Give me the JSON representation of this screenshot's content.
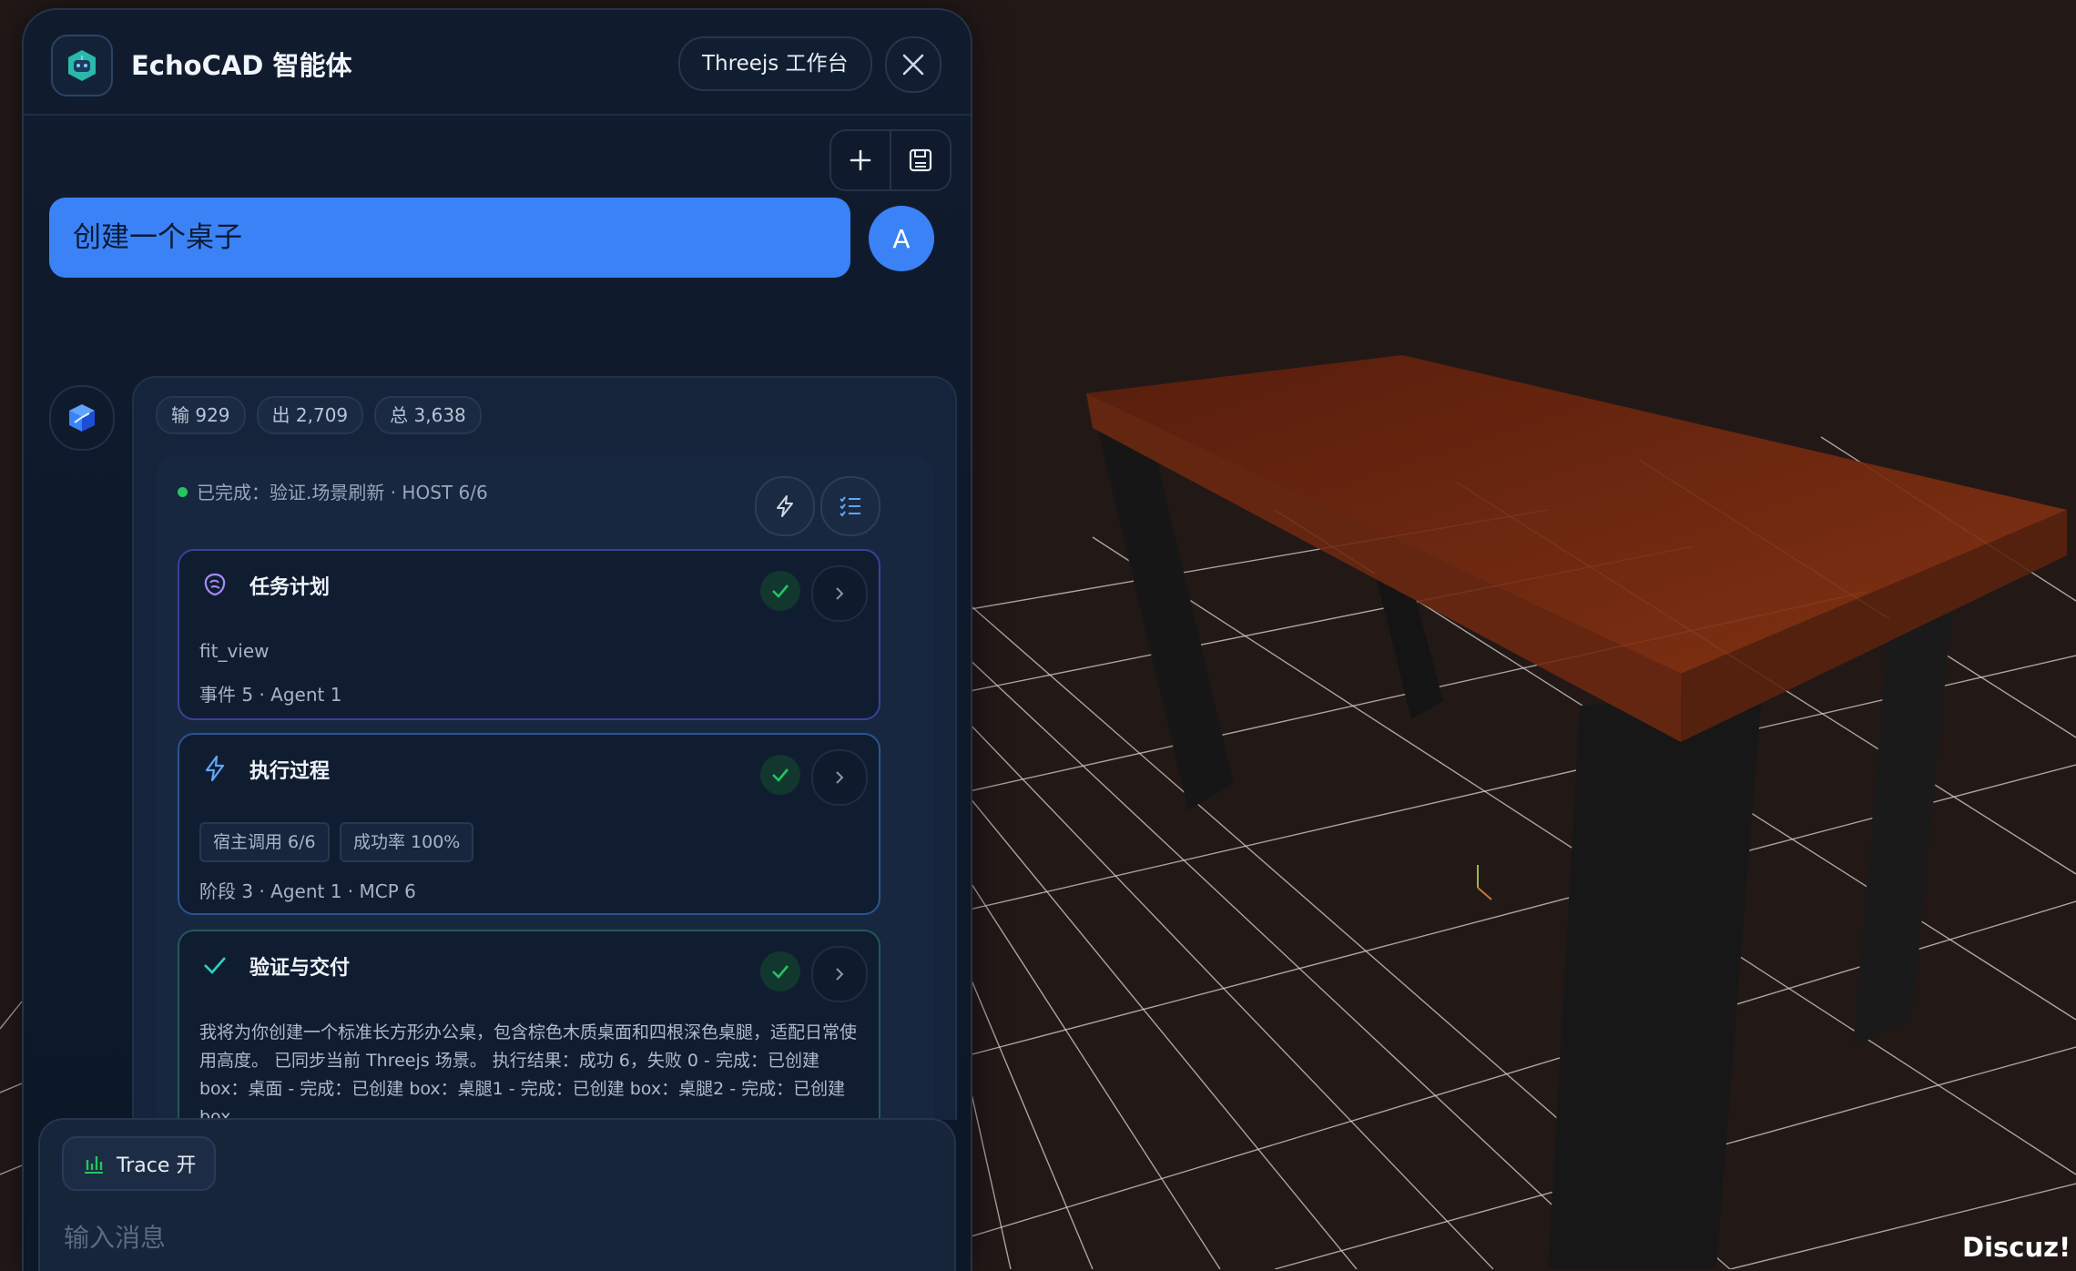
{
  "header": {
    "title": "EchoCAD 智能体",
    "mode_label": "Threejs 工作台"
  },
  "conversation": {
    "user_message": "创建一个桌子",
    "user_avatar": "A",
    "tokens": {
      "input": "输 929",
      "output": "出 2,709",
      "total": "总 3,638"
    },
    "status": "已完成：验证.场景刷新 · HOST 6/6",
    "steps": {
      "plan": {
        "title": "任务计划",
        "detail": "fit_view",
        "meta": "事件 5 · Agent 1"
      },
      "exec": {
        "title": "执行过程",
        "chips": [
          "宿主调用 6/6",
          "成功率 100%"
        ],
        "meta": "阶段 3 · Agent 1 · MCP 6"
      },
      "verify": {
        "title": "验证与交付",
        "text": "我将为你创建一个标准长方形办公桌，包含棕色木质桌面和四根深色桌腿，适配日常使用高度。 已同步当前 Threejs 场景。 执行结果：成功 6，失败 0 - 完成：已创建 box：桌面 - 完成：已创建 box：桌腿1 - 完成：已创建 box：桌腿2 - 完成：已创建 box"
      }
    }
  },
  "composer": {
    "trace_label": "Trace 开",
    "placeholder": "输入消息"
  },
  "watermark": "Discuz!",
  "colors": {
    "accent_blue": "#3b82f6",
    "success_green": "#22c55e",
    "table_top": "#7a2e10",
    "background": "#221917"
  }
}
